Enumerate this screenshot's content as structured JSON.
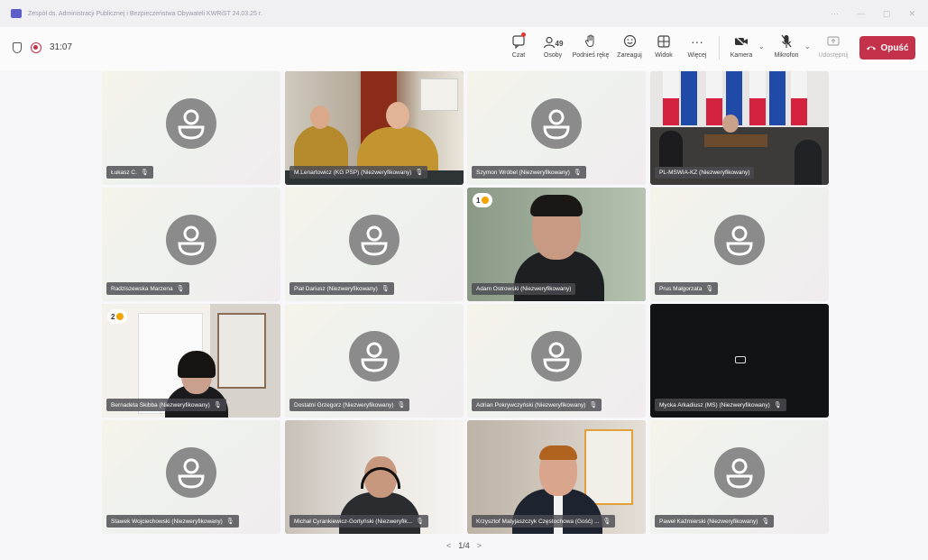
{
  "window": {
    "title": "Zespół ds. Administracji Publicznej i Bezpieczeństwa Obywateli KWRiST 24.03.25 r.",
    "controls": [
      "⋯",
      "—",
      "▢",
      "✕"
    ]
  },
  "toolbar": {
    "timer": "31:07",
    "chat_label": "Czat",
    "people_label": "Osoby",
    "people_count": "49",
    "raise_hand_label": "Podnieś rękę",
    "react_label": "Zareaguj",
    "view_label": "Widok",
    "more_label": "Więcej",
    "camera_label": "Kamera",
    "mic_label": "Mikrofon",
    "share_label": "Udostępnij",
    "leave_label": "Opuść",
    "colors": {
      "leave": "#c4314b",
      "accent": "#5b5fc7"
    }
  },
  "participants": [
    {
      "name": "Łukasz C.",
      "mic": "mic-icon",
      "kind": "avatar"
    },
    {
      "name": "M.Lenartowicz (KG PSP) (Niezweryfikowany)",
      "mic": "mic-icon",
      "kind": "video-fire"
    },
    {
      "name": "Szymon Wróbel (Niezweryfikowany)",
      "mic": "mic-icon",
      "kind": "avatar"
    },
    {
      "name": "PL-MSWiA-KZ (Niezweryfikowany)",
      "mic": "",
      "kind": "video-flags"
    },
    {
      "name": "Radziszewska Marzena",
      "mic": "mic-icon",
      "kind": "avatar"
    },
    {
      "name": "Piał Dariusz (Niezweryfikowany)",
      "mic": "mic-icon",
      "kind": "avatar"
    },
    {
      "name": "Adam Ostrowski (Niezweryfikowany)",
      "mic": "",
      "kind": "video-man",
      "badge": "1"
    },
    {
      "name": "Prus Małgorzata",
      "mic": "mic-icon",
      "kind": "avatar"
    },
    {
      "name": "Bernadeta Skibba (Niezweryfikowany)",
      "mic": "mic-icon",
      "kind": "video-woman",
      "badge": "2"
    },
    {
      "name": "Dostatni Grzegorz (Niezweryfikowany)",
      "mic": "mic-icon",
      "kind": "avatar"
    },
    {
      "name": "Adrian Pokrywczyński (Niezweryfikowany)",
      "mic": "mic-icon",
      "kind": "avatar"
    },
    {
      "name": "Mycka Arkadiusz (MS) (Niezweryfikowany)",
      "mic": "mic-icon",
      "kind": "dark"
    },
    {
      "name": "Stawek Wojciechowski (Niezweryfikowany)",
      "mic": "mic-icon",
      "kind": "avatar"
    },
    {
      "name": "Michał Cyrankiewicz-Gortyński (Niezweryfik...",
      "mic": "mic-icon",
      "kind": "video-headset"
    },
    {
      "name": "Krzysztof Matyjaszczyk Częstochowa (Gość) ...",
      "mic": "mic-icon",
      "kind": "video-suit"
    },
    {
      "name": "Paweł Kaźmierski (Niezweryfikowany)",
      "mic": "mic-icon",
      "kind": "avatar"
    }
  ],
  "pager": {
    "label": "1/4"
  }
}
